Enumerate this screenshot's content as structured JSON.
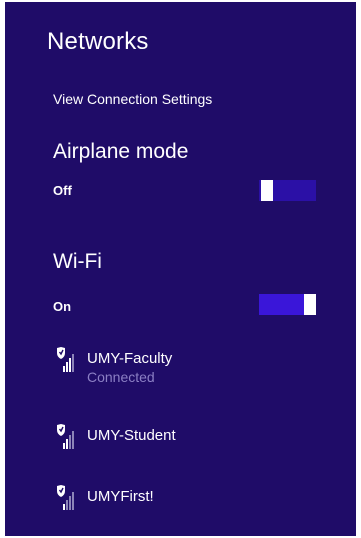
{
  "panel": {
    "title": "Networks",
    "view_connection_settings": "View Connection Settings"
  },
  "airplane_mode": {
    "label": "Airplane mode",
    "state_label": "Off",
    "enabled": false
  },
  "wifi": {
    "label": "Wi-Fi",
    "state_label": "On",
    "enabled": true
  },
  "networks": [
    {
      "name": "UMY-Faculty",
      "status": "Connected",
      "icon": "secured-wifi-signal-icon"
    },
    {
      "name": "UMY-Student",
      "status": "",
      "icon": "secured-wifi-signal-icon"
    },
    {
      "name": "UMYFirst!",
      "status": "",
      "icon": "secured-wifi-signal-icon"
    }
  ],
  "colors": {
    "panel_background": "#1f0c68",
    "toggle_on": "#3a16d9",
    "toggle_off": "#2b10a6",
    "secondary_text": "#8b7fc4"
  }
}
